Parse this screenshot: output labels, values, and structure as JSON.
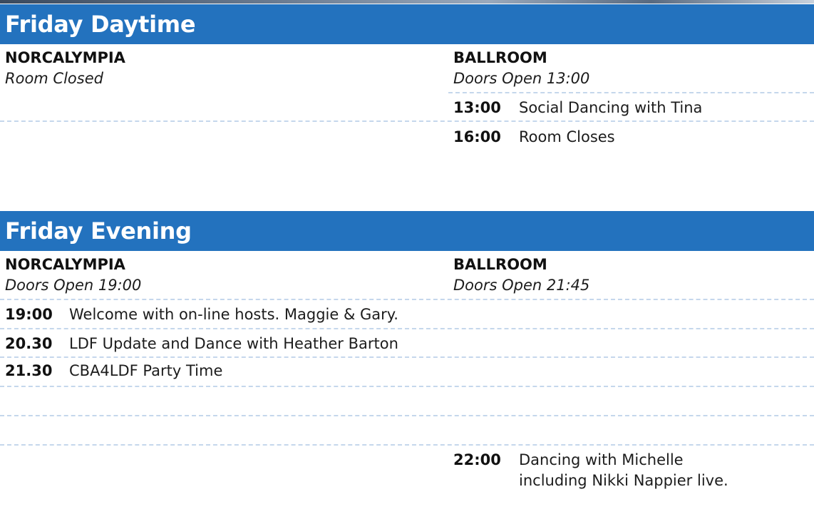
{
  "daytime": {
    "title": "Friday Daytime",
    "left": {
      "room": "NORCALYMPIA",
      "note": "Room Closed"
    },
    "right": {
      "room": "BALLROOM",
      "note": "Doors Open 13:00",
      "events": [
        {
          "time": "13:00",
          "desc": "Social Dancing with Tina"
        },
        {
          "time": "16:00",
          "desc": "Room Closes"
        }
      ]
    }
  },
  "evening": {
    "title": "Friday Evening",
    "left": {
      "room": "NORCALYMPIA",
      "note": "Doors Open 19:00",
      "events": [
        {
          "time": "19:00",
          "desc": "Welcome with on-line hosts. Maggie & Gary."
        },
        {
          "time": "20.30",
          "desc": "LDF Update and Dance with Heather Barton"
        },
        {
          "time": "21.30",
          "desc": "CBA4LDF Party Time"
        }
      ]
    },
    "right": {
      "room": "BALLROOM",
      "note": "Doors Open 21:45",
      "events": [
        {
          "time": "22:00",
          "desc_line1": "Dancing with Michelle",
          "desc_line2": "including Nikki Nappier live."
        }
      ]
    }
  },
  "colors": {
    "band": "#2372be",
    "dash": "#c5d7ec"
  }
}
